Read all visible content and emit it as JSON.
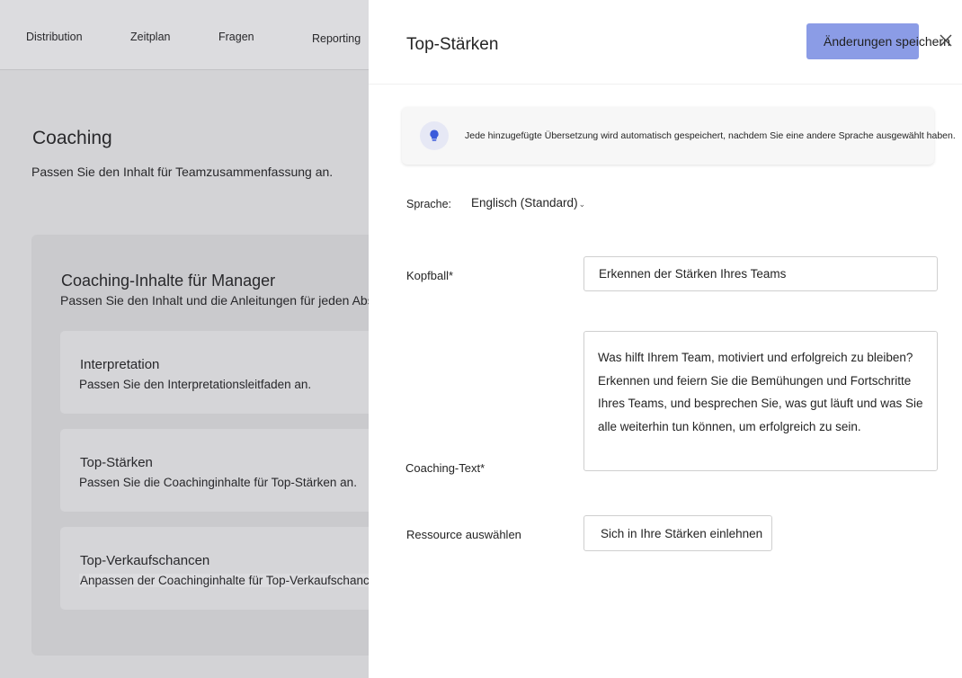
{
  "nav": {
    "items": [
      {
        "label": "Distribution"
      },
      {
        "label": "Zeitplan"
      },
      {
        "label": "Fragen"
      },
      {
        "label": "Reporting"
      }
    ]
  },
  "page": {
    "title": "Coaching",
    "subtitle": "Passen Sie den Inhalt für Teamzusammenfassung an."
  },
  "manager_card": {
    "title": "Coaching-Inhalte für Manager",
    "subtitle": "Passen Sie den Inhalt und die Anleitungen für jeden Abschnitt an.",
    "sections": [
      {
        "title": "Interpretation",
        "description": "Passen Sie den Interpretationsleitfaden an."
      },
      {
        "title": "Top-Stärken",
        "description": "Passen Sie die Coachinginhalte für Top-Stärken an."
      },
      {
        "title": "Top-Verkaufschancen",
        "description": "Anpassen der Coachinginhalte für Top-Verkaufschancen"
      }
    ]
  },
  "panel": {
    "title": "Top-Stärken",
    "save_label": "Änderungen speichern",
    "close_icon": "close-icon",
    "info": {
      "icon": "lightbulb-icon",
      "text": "Jede hinzugefügte Übersetzung wird automatisch gespeichert, nachdem Sie eine andere Sprache ausgewählt haben."
    },
    "language": {
      "label": "Sprache:",
      "value": "Englisch (Standard)"
    },
    "header_field": {
      "label": "Kopfball*",
      "value": "Erkennen der Stärken Ihres Teams"
    },
    "coaching_text": {
      "label": "Coaching-Text*",
      "value": "Was hilft Ihrem Team, motiviert und erfolgreich zu bleiben? Erkennen und feiern Sie die Bemühungen und Fortschritte Ihres Teams, und besprechen Sie, was gut läuft und was Sie alle weiterhin tun können, um erfolgreich zu sein."
    },
    "resource": {
      "label": "Ressource auswählen",
      "value": "Sich in Ihre Stärken einlehnen"
    }
  },
  "colors": {
    "accent": "#8b9ce6",
    "lightbulb": "#3b5bdb"
  }
}
